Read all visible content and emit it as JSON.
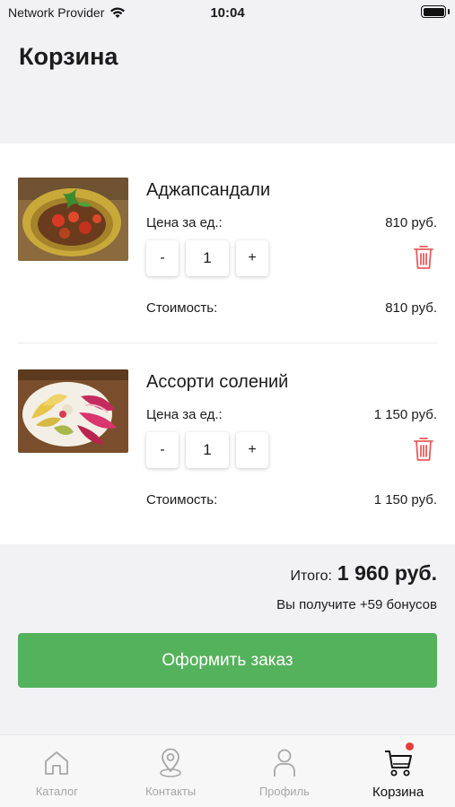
{
  "status_bar": {
    "carrier": "Network Provider",
    "time": "10:04"
  },
  "page_title": "Корзина",
  "cart_items": [
    {
      "name": "Аджапсандали",
      "unit_price_label": "Цена за ед.:",
      "unit_price": "810 руб.",
      "decrease_label": "-",
      "quantity": "1",
      "increase_label": "+",
      "cost_label": "Стоимость:",
      "cost": "810 руб."
    },
    {
      "name": "Ассорти солений",
      "unit_price_label": "Цена за ед.:",
      "unit_price": "1 150 руб.",
      "decrease_label": "-",
      "quantity": "1",
      "increase_label": "+",
      "cost_label": "Стоимость:",
      "cost": "1 150 руб."
    }
  ],
  "summary": {
    "total_label": "Итого:",
    "total_value": "1 960 руб.",
    "bonus_text": "Вы получите +59 бонусов"
  },
  "checkout_button": "Оформить заказ",
  "tab_bar": {
    "tabs": [
      {
        "label": "Каталог",
        "icon": "home-icon",
        "active": false
      },
      {
        "label": "Контакты",
        "icon": "location-pin-icon",
        "active": false
      },
      {
        "label": "Профиль",
        "icon": "person-icon",
        "active": false
      },
      {
        "label": "Корзина",
        "icon": "cart-icon",
        "active": true
      }
    ]
  },
  "colors": {
    "accent_green": "#55b25c",
    "delete_red": "#e85c5c",
    "badge_red": "#ef3b3b",
    "background": "#f2f2f4",
    "inactive_tab": "#a7a7a7"
  }
}
